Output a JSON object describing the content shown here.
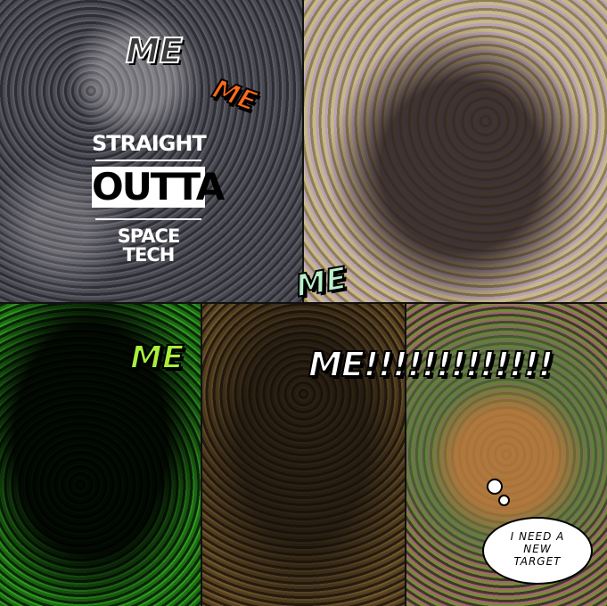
{
  "labels": {
    "me_top": "ME",
    "me_orange": "ME",
    "me_center": "ME",
    "me_green": "ME",
    "me_shout": "ME!!!!!!!!!!!!!"
  },
  "logo": {
    "line1": "STRAIGHT",
    "line2": "OUTTA",
    "line3": "SPACE TECH"
  },
  "thought_bubble": {
    "line1": "I NEED A",
    "line2": "NEW",
    "line3": "TARGET"
  },
  "colors": {
    "me_orange": "#ff6a1a",
    "me_mint": "#b7f0c9",
    "me_lime": "#a8f03a"
  }
}
